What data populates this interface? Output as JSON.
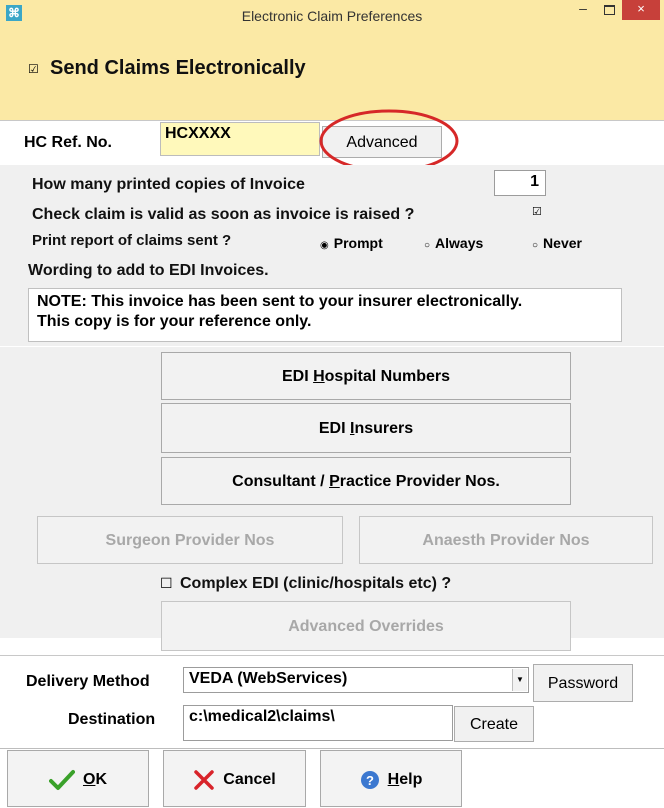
{
  "window": {
    "title": "Electronic Claim Preferences",
    "minimize": "–",
    "close": "×",
    "app_icon": "⌘"
  },
  "send": {
    "checked": "☑",
    "label": "Send Claims Electronically"
  },
  "hc": {
    "label": "HC Ref. No.",
    "value": "HCXXXX",
    "advanced_button": "Advanced"
  },
  "options": {
    "copies_label": "How many printed copies of Invoice",
    "copies_value": "1",
    "valid_label": "Check claim is valid as soon as invoice is raised ?",
    "valid_check": "☑",
    "report_label": "Print report of claims sent ?",
    "radios": [
      {
        "label": "Prompt",
        "mark": "◉"
      },
      {
        "label": "Always",
        "mark": "○"
      },
      {
        "label": "Never",
        "mark": "○"
      }
    ]
  },
  "wording": {
    "label": "Wording to add to EDI Invoices.",
    "text": "NOTE: This invoice has been sent to your insurer electronically.\nThis copy is for your reference only."
  },
  "buttons": {
    "hospital_pre": "EDI ",
    "hospital_u": "H",
    "hospital_post": "ospital Numbers",
    "insurers_pre": "EDI ",
    "insurers_u": "I",
    "insurers_post": "nsurers",
    "consultant_pre": "Consultant / ",
    "consultant_u": "P",
    "consultant_post": "ractice Provider Nos.",
    "surgeon": "Surgeon Provider Nos",
    "anaesth": "Anaesth Provider Nos",
    "complex_check": "☐",
    "complex_label": "Complex EDI (clinic/hospitals etc) ?",
    "overrides": "Advanced Overrides"
  },
  "delivery": {
    "label": "Delivery Method",
    "value": "VEDA (WebServices)",
    "arrow": "▼",
    "password_button": "Password",
    "dest_label": "Destination",
    "dest_value": "c:\\medical2\\claims\\",
    "create_button": "Create"
  },
  "footer": {
    "ok_u": "O",
    "ok_post": "K",
    "cancel": "Cancel",
    "help_u": "H",
    "help_post": "elp"
  },
  "colors": {
    "title_yellow": "#fbe9a5",
    "input_yellow": "#fff9bb",
    "circle_red": "#d62828",
    "close_red": "#c7403a",
    "ok_green": "#3aa12a",
    "cancel_red": "#d8232a",
    "help_blue": "#3b78d0"
  }
}
